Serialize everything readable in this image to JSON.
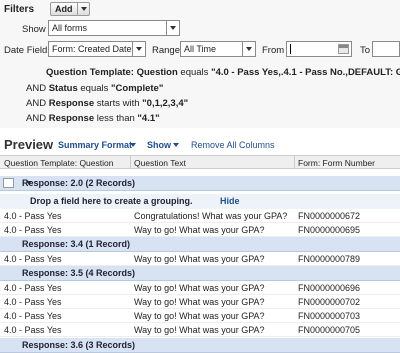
{
  "filters": {
    "title": "Filters",
    "add_label": "Add",
    "show_label": "Show",
    "show_value": "All forms",
    "date_field_label": "Date Field",
    "date_field_value": "Form: Created Date",
    "range_label": "Range",
    "range_value": "All Time",
    "from_label": "From",
    "from_value": "",
    "to_label": "To",
    "criteria": [
      {
        "prefix": "",
        "field": "Question Template: Question",
        "op": " equals ",
        "value": "\"4.0 - Pass Yes,.4.1 - Pass No.,DEFAULT: GPA\""
      },
      {
        "prefix": "AND ",
        "field": "Status",
        "op": " equals ",
        "value": "\"Complete\""
      },
      {
        "prefix": "AND ",
        "field": "Response",
        "op": " starts with ",
        "value": "\"0,1,2,3,4\""
      },
      {
        "prefix": "AND ",
        "field": "Response",
        "op": " less than ",
        "value": "\"4.1\""
      }
    ]
  },
  "preview": {
    "title": "Preview",
    "format_label": "Summary Format",
    "show_label": "Show",
    "remove_columns_label": "Remove All Columns"
  },
  "columns": [
    "Question Template: Question",
    "Question Text",
    "Form: Form Number"
  ],
  "drop_hint": {
    "text": "Drop a field here to create a grouping.",
    "hide_label": "Hide"
  },
  "groups": [
    {
      "label": "Response: 2.0 (2 Records)",
      "rows": [
        [
          "4.0 - Pass Yes",
          "Congratulations! What was your GPA?",
          "FN0000000672"
        ],
        [
          "4.0 - Pass Yes",
          "Way to go! What was your GPA?",
          "FN0000000695"
        ]
      ]
    },
    {
      "label": "Response: 3.4 (1 Record)",
      "rows": [
        [
          "4.0 - Pass Yes",
          "Way to go! What was your GPA?",
          "FN0000000789"
        ]
      ]
    },
    {
      "label": "Response: 3.5 (4 Records)",
      "rows": [
        [
          "4.0 - Pass Yes",
          "Way to go! What was your GPA?",
          "FN0000000696"
        ],
        [
          "4.0 - Pass Yes",
          "Way to go! What was your GPA?",
          "FN0000000702"
        ],
        [
          "4.0 - Pass Yes",
          "Way to go! What was your GPA?",
          "FN0000000703"
        ],
        [
          "4.0 - Pass Yes",
          "Way to go! What was your GPA?",
          "FN0000000705"
        ]
      ]
    },
    {
      "label": "Response: 3.6 (3 Records)",
      "rows": []
    }
  ]
}
